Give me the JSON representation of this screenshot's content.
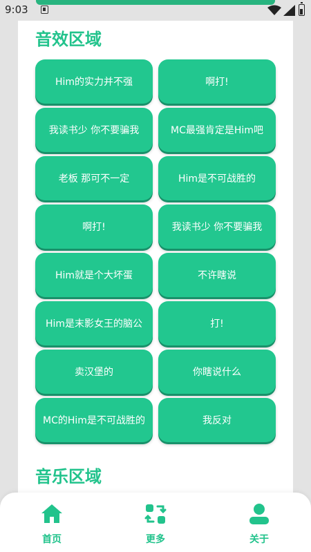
{
  "status_bar": {
    "time": "9:03"
  },
  "sections": {
    "sound_title": "音效区域",
    "music_title": "音乐区域"
  },
  "sound_buttons": [
    "Him的实力并不强",
    "啊打!",
    "我读书少 你不要骗我",
    "MC最强肯定是Him吧",
    "老板 那可不一定",
    "Him是不可战胜的",
    "啊打!",
    "我读书少 你不要骗我",
    "Him就是个大坏蛋",
    "不许瞎说",
    "Him是末影女王的脑公",
    "打!",
    "卖汉堡的",
    "你瞎说什么",
    "MC的Him是不可战胜的",
    "我反对"
  ],
  "bottom_nav": {
    "home_label": "首页",
    "more_label": "更多",
    "about_label": "关于"
  },
  "icons": {
    "home": "home-icon",
    "more": "swap-grid-icon",
    "about": "user-icon"
  },
  "colors": {
    "accent": "#22c38c",
    "button": "#22c78f",
    "button_shadow": "#19916a",
    "status_strip": "#28b47f"
  }
}
